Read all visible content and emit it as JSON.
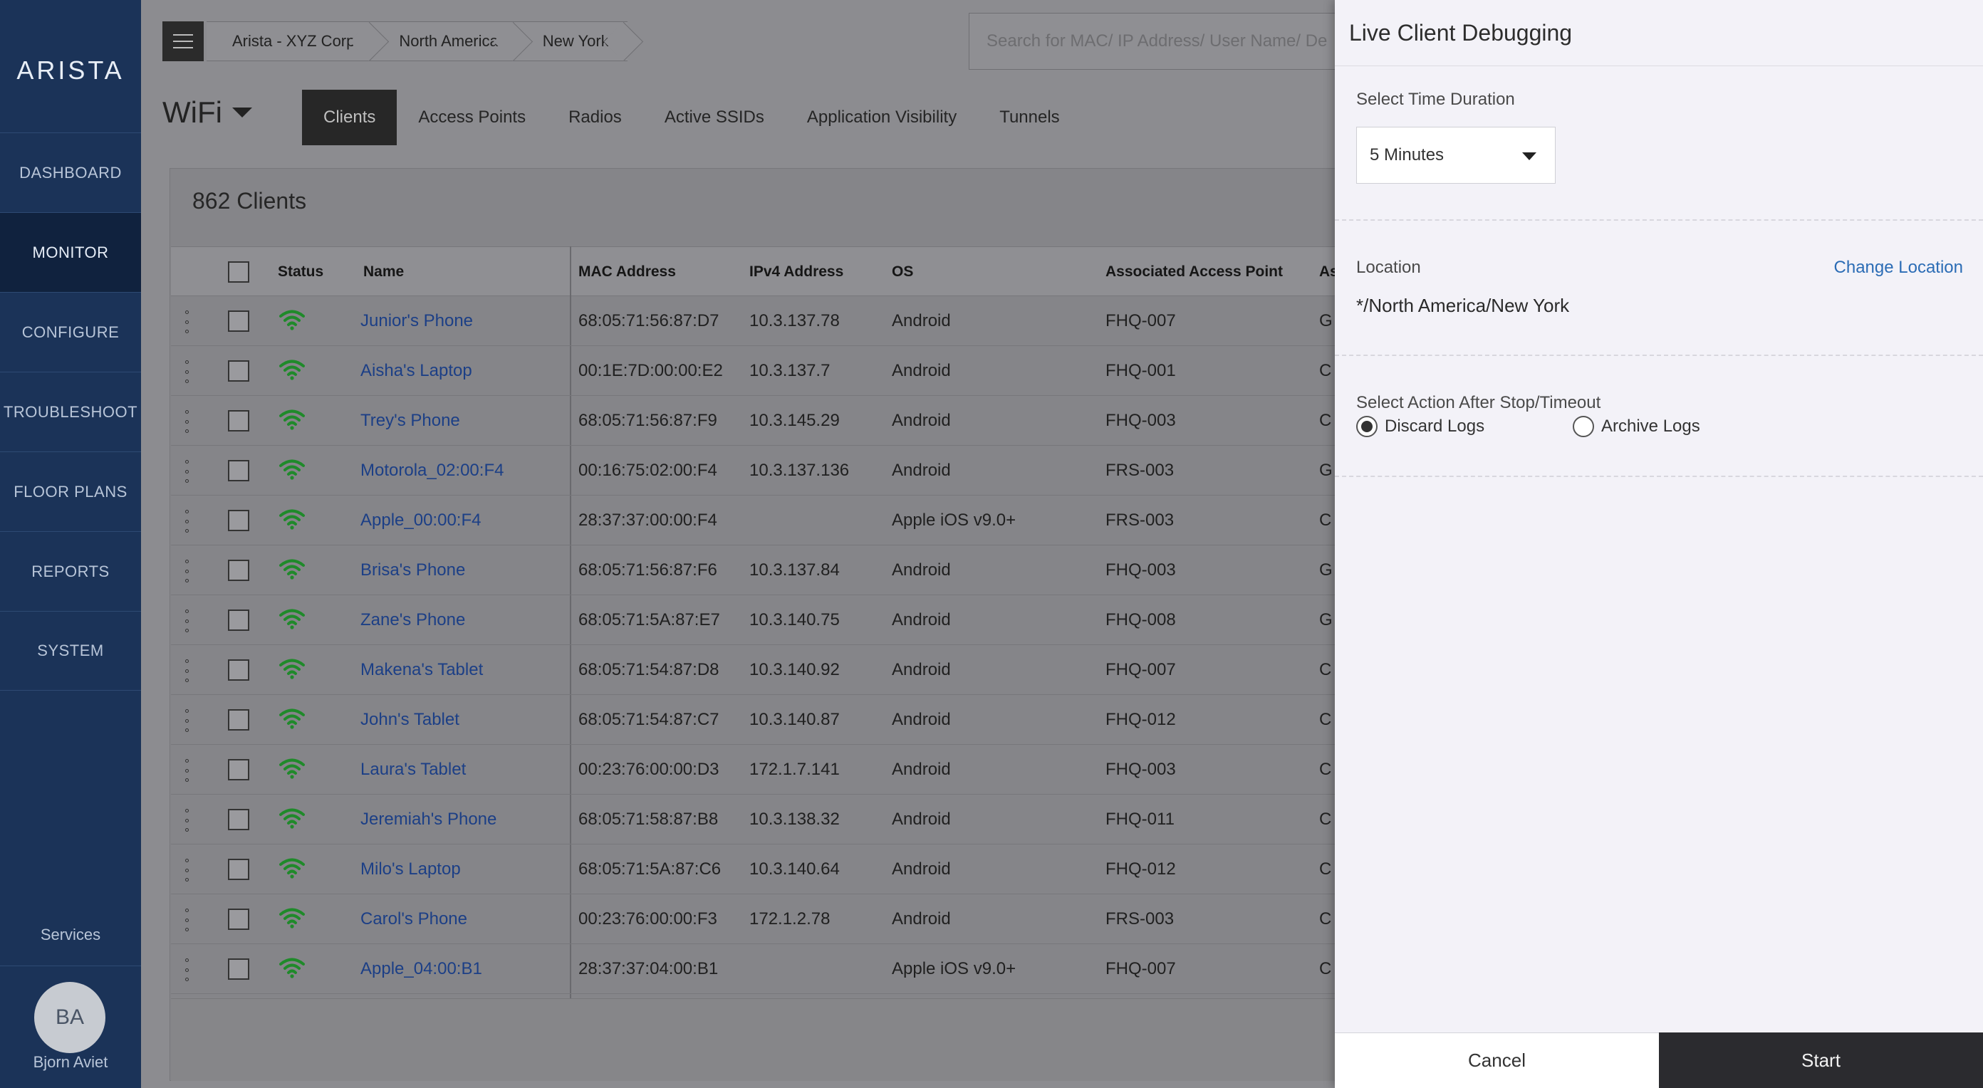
{
  "sidebar": {
    "logo": "ARISTA",
    "items": [
      {
        "label": "DASHBOARD"
      },
      {
        "label": "MONITOR"
      },
      {
        "label": "CONFIGURE"
      },
      {
        "label": "TROUBLESHOOT"
      },
      {
        "label": "FLOOR PLANS"
      },
      {
        "label": "REPORTS"
      },
      {
        "label": "SYSTEM"
      }
    ],
    "active_item": "MONITOR",
    "services_label": "Services",
    "user": {
      "initials": "BA",
      "name": "Bjorn Aviet"
    }
  },
  "breadcrumb": [
    "Arista - XYZ Corp",
    "North America",
    "New York"
  ],
  "search": {
    "placeholder": "Search for MAC/ IP Address/ User Name/ De"
  },
  "section": {
    "title": "WiFi"
  },
  "tabs": [
    {
      "label": "Clients",
      "active": true
    },
    {
      "label": "Access Points"
    },
    {
      "label": "Radios"
    },
    {
      "label": "Active SSIDs"
    },
    {
      "label": "Application Visibility"
    },
    {
      "label": "Tunnels"
    }
  ],
  "clients": {
    "count_label": "862 Clients",
    "columns": {
      "status": "Status",
      "name": "Name",
      "mac": "MAC Address",
      "ipv4": "IPv4 Address",
      "os": "OS",
      "ap": "Associated Access Point",
      "extra": "As"
    },
    "rows": [
      {
        "name": "Junior's Phone",
        "mac": "68:05:71:56:87:D7",
        "ip": "10.3.137.78",
        "os": "Android",
        "ap": "FHQ-007",
        "extra": "G"
      },
      {
        "name": "Aisha's Laptop",
        "mac": "00:1E:7D:00:00:E2",
        "ip": "10.3.137.7",
        "os": "Android",
        "ap": "FHQ-001",
        "extra": "C"
      },
      {
        "name": "Trey's Phone",
        "mac": "68:05:71:56:87:F9",
        "ip": "10.3.145.29",
        "os": "Android",
        "ap": "FHQ-003",
        "extra": "C"
      },
      {
        "name": "Motorola_02:00:F4",
        "mac": "00:16:75:02:00:F4",
        "ip": "10.3.137.136",
        "os": "Android",
        "ap": "FRS-003",
        "extra": "G"
      },
      {
        "name": "Apple_00:00:F4",
        "mac": "28:37:37:00:00:F4",
        "ip": "",
        "os": "Apple iOS v9.0+",
        "ap": "FRS-003",
        "extra": "C"
      },
      {
        "name": "Brisa's Phone",
        "mac": "68:05:71:56:87:F6",
        "ip": "10.3.137.84",
        "os": "Android",
        "ap": "FHQ-003",
        "extra": "G"
      },
      {
        "name": "Zane's Phone",
        "mac": "68:05:71:5A:87:E7",
        "ip": "10.3.140.75",
        "os": "Android",
        "ap": "FHQ-008",
        "extra": "G"
      },
      {
        "name": "Makena's Tablet",
        "mac": "68:05:71:54:87:D8",
        "ip": "10.3.140.92",
        "os": "Android",
        "ap": "FHQ-007",
        "extra": "C"
      },
      {
        "name": "John's Tablet",
        "mac": "68:05:71:54:87:C7",
        "ip": "10.3.140.87",
        "os": "Android",
        "ap": "FHQ-012",
        "extra": "C"
      },
      {
        "name": "Laura's Tablet",
        "mac": "00:23:76:00:00:D3",
        "ip": "172.1.7.141",
        "os": "Android",
        "ap": "FHQ-003",
        "extra": "C"
      },
      {
        "name": "Jeremiah's Phone",
        "mac": "68:05:71:58:87:B8",
        "ip": "10.3.138.32",
        "os": "Android",
        "ap": "FHQ-011",
        "extra": "C"
      },
      {
        "name": "Milo's Laptop",
        "mac": "68:05:71:5A:87:C6",
        "ip": "10.3.140.64",
        "os": "Android",
        "ap": "FHQ-012",
        "extra": "C"
      },
      {
        "name": "Carol's Phone",
        "mac": "00:23:76:00:00:F3",
        "ip": "172.1.2.78",
        "os": "Android",
        "ap": "FRS-003",
        "extra": "C"
      },
      {
        "name": "Apple_04:00:B1",
        "mac": "28:37:37:04:00:B1",
        "ip": "",
        "os": "Apple iOS v9.0+",
        "ap": "FHQ-007",
        "extra": "C"
      }
    ]
  },
  "drawer": {
    "title": "Live Client Debugging",
    "duration_label": "Select Time Duration",
    "duration_value": "5 Minutes",
    "location_label": "Location",
    "change_location": "Change Location",
    "location_value": "*/North America/New York",
    "action_label": "Select Action After Stop/Timeout",
    "option_discard": "Discard Logs",
    "option_archive": "Archive Logs",
    "selected_option": "Discard Logs",
    "cancel_label": "Cancel",
    "start_label": "Start"
  },
  "colors": {
    "sidebar_bg": "#1b3358",
    "link": "#2b6cb5",
    "wifi_icon": "#1f8a2a",
    "start_button": "#2b2b2f"
  }
}
